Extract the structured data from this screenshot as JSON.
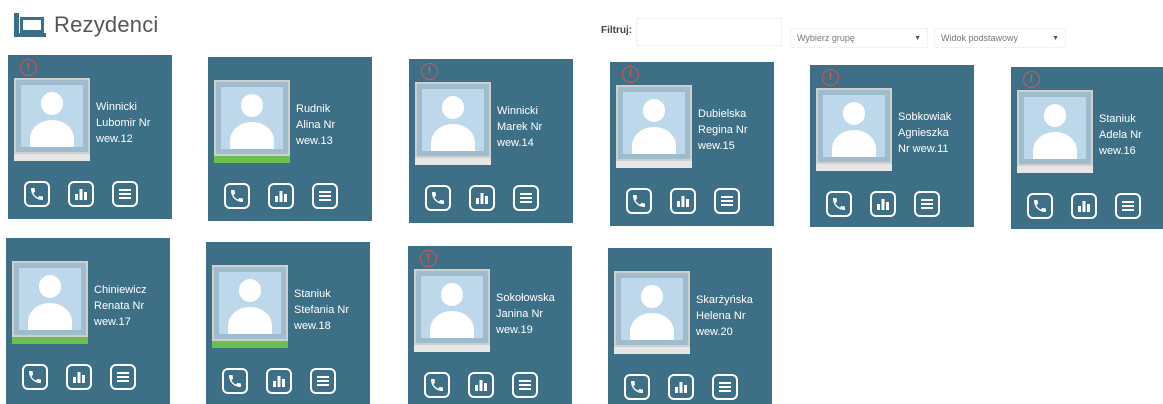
{
  "header": {
    "title": "Rezydenci"
  },
  "filters": {
    "label": "Filtruj:",
    "input_value": "",
    "group_select": "Wybierz grupę",
    "view_select": "Widok podstawowy"
  },
  "residents": [
    {
      "line1": "Winnicki",
      "line2": "Lubomir Nr",
      "line3": "wew.12",
      "alert": true,
      "status": "gray"
    },
    {
      "line1": "Rudnik",
      "line2": "Alina Nr",
      "line3": "wew.13",
      "alert": false,
      "status": "green"
    },
    {
      "line1": "Winnicki",
      "line2": "Marek Nr",
      "line3": "wew.14",
      "alert": true,
      "status": "gray"
    },
    {
      "line1": "Dubielska",
      "line2": "Regina Nr",
      "line3": "wew.15",
      "alert": true,
      "status": "gray"
    },
    {
      "line1": "Sobkowiak",
      "line2": "Agnieszka",
      "line3": "Nr wew.11",
      "alert": true,
      "status": "gray"
    },
    {
      "line1": "Staniuk",
      "line2": "Adela Nr",
      "line3": "wew.16",
      "alert": true,
      "status": "gray"
    },
    {
      "line1": "Chiniewicz",
      "line2": "Renata Nr",
      "line3": "wew.17",
      "alert": false,
      "status": "green"
    },
    {
      "line1": "Staniuk",
      "line2": "Stefania Nr",
      "line3": "wew.18",
      "alert": false,
      "status": "green"
    },
    {
      "line1": "Sokołowska",
      "line2": "Janina Nr",
      "line3": "wew.19",
      "alert": true,
      "status": "gray"
    },
    {
      "line1": "Skarżyńska",
      "line2": "Helena Nr",
      "line3": "wew.20",
      "alert": false,
      "status": "gray"
    }
  ],
  "icons": {
    "header": "monitor-icon",
    "alert": "alert-circle-icon",
    "call": "phone-icon",
    "stats": "bar-chart-icon",
    "menu": "list-icon",
    "avatar": "avatar-placeholder-icon"
  },
  "colors": {
    "card_bg": "#3d6f86",
    "alert": "#d9534f",
    "status_ok": "#6bbf4e",
    "status_default": "#e6e6e6"
  }
}
